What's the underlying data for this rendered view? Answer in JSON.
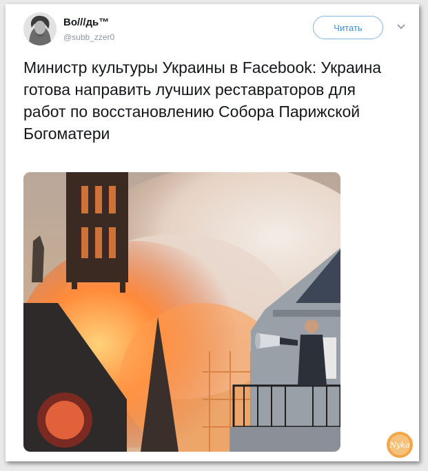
{
  "tweet": {
    "display_name": "Во///дь™",
    "handle": "@subb_zzer0",
    "follow_label": "Читать",
    "text": "Министр культуры Украины в Facebook: Украина готова направить лучших реставраторов для работ по восстановлению Собора Парижской Богоматери"
  },
  "watermark": {
    "text": "Nyka"
  },
  "icons": [
    "avatar-portrait",
    "chevron-down-icon",
    "nyka-badge"
  ],
  "colors": {
    "follow_border": "#7fb6de",
    "follow_text": "#3a8ed0",
    "badge_fill": "#f2a64a"
  }
}
